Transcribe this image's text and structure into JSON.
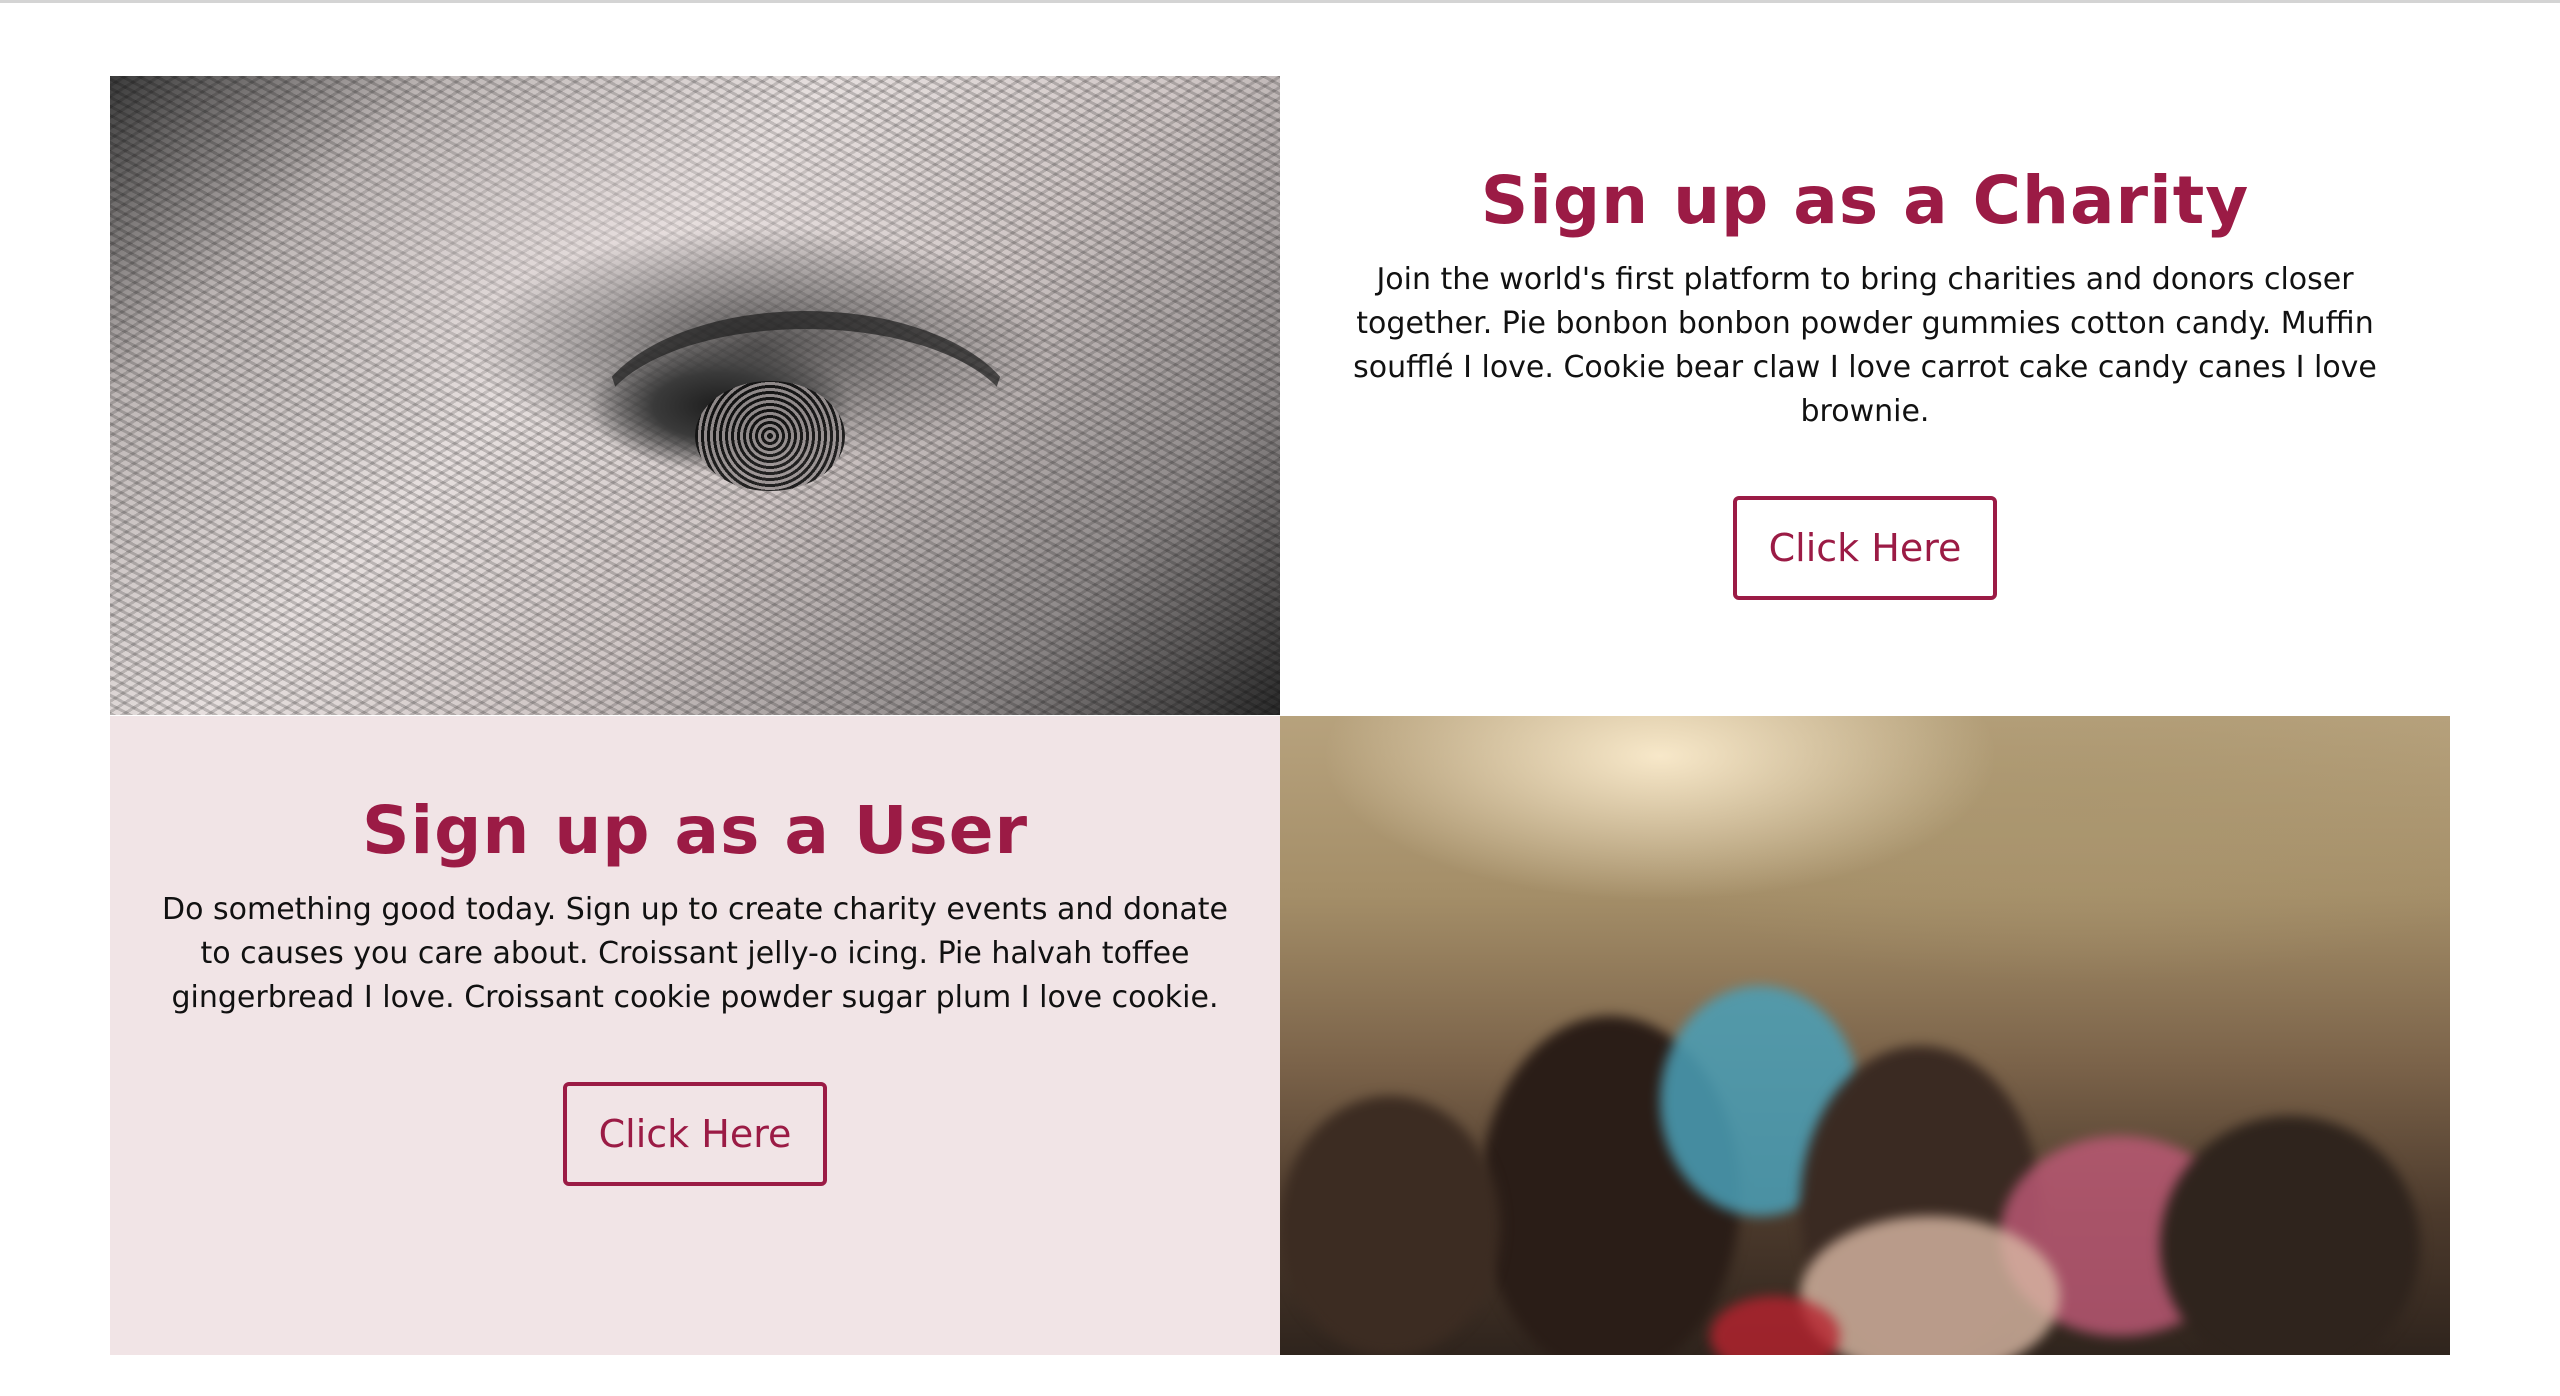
{
  "charity": {
    "title": "Sign up as a Charity",
    "description": "Join the world's first platform to bring charities and donors closer together. Pie bonbon bonbon powder gummies cotton candy. Muffin soufflé I love. Cookie bear claw I love carrot cake candy canes I love brownie.",
    "button_label": "Click Here",
    "image": "dollar-bill-eye-photo"
  },
  "user": {
    "title": "Sign up as a User",
    "description": "Do something good today. Sign up to create charity events and donate to causes you care about. Croissant jelly-o icing. Pie halvah toffee gingerbread I love. Croissant cookie powder sugar plum I love cookie.",
    "button_label": "Click Here",
    "image": "crowd-raised-hands-photo"
  },
  "colors": {
    "accent": "#9b1b45",
    "user_panel_bg": "#f1e4e6",
    "text": "#111111"
  }
}
